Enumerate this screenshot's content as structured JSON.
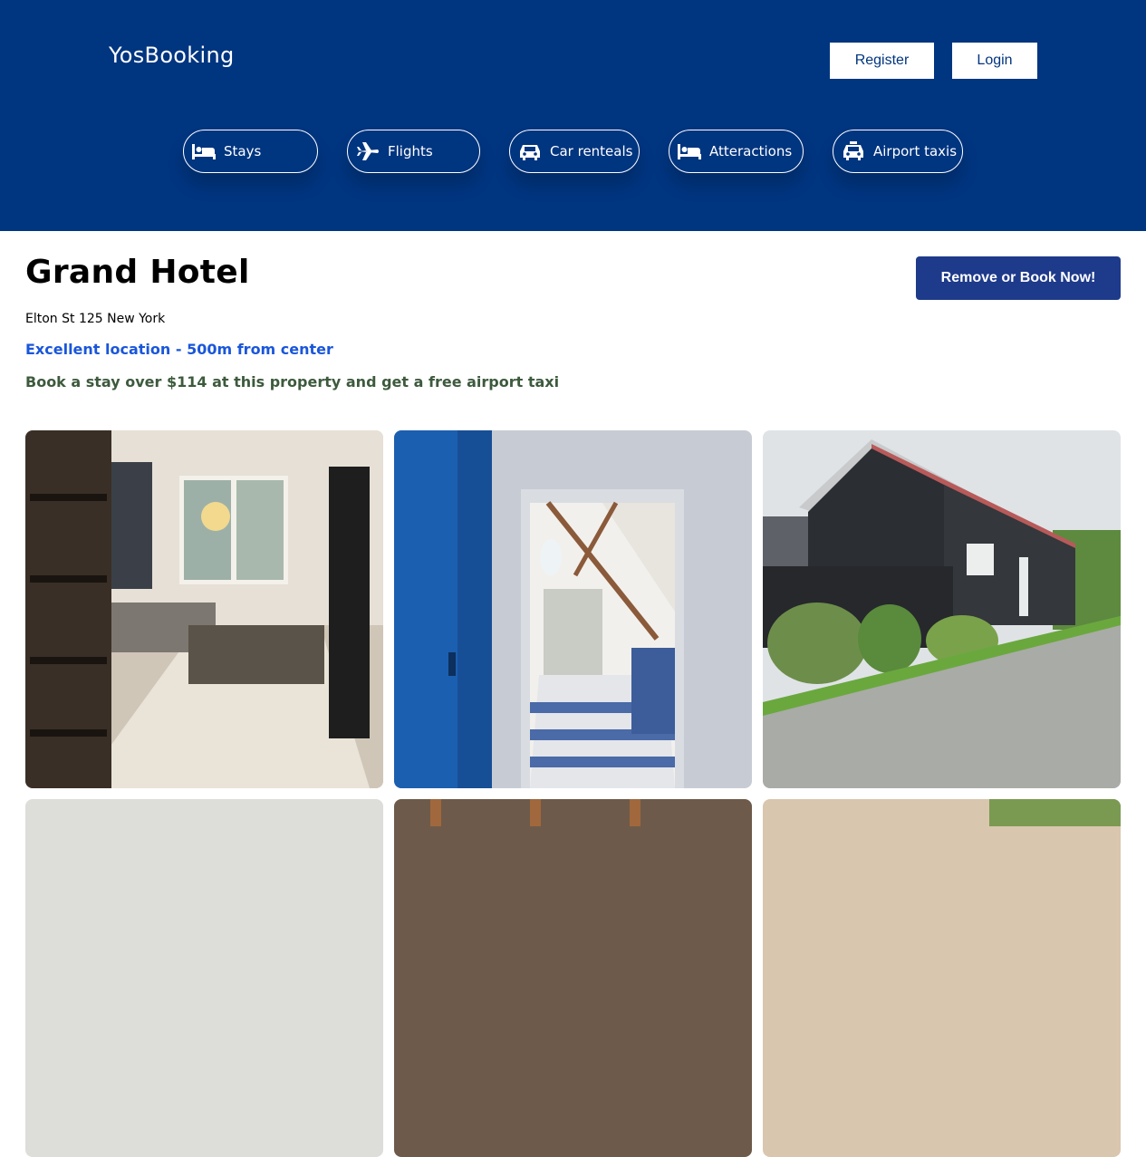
{
  "header": {
    "brand": "YosBooking",
    "register_label": "Register",
    "login_label": "Login",
    "nav": [
      {
        "label": "Stays",
        "icon": "bed-icon"
      },
      {
        "label": "Flights",
        "icon": "plane-icon"
      },
      {
        "label": "Car renteals",
        "icon": "car-icon"
      },
      {
        "label": "Atteractions",
        "icon": "bed-icon"
      },
      {
        "label": "Airport taxis",
        "icon": "taxi-icon"
      }
    ]
  },
  "hotel": {
    "name": "Grand Hotel",
    "book_button": "Remove or Book Now!",
    "address": "Elton St 125 New York",
    "location": "Excellent location - 500m from center",
    "offer": "Book a stay over $114 at this property and get a free airport taxi"
  },
  "colors": {
    "header_bg": "#003580",
    "book_button": "#1e3a8a",
    "location_text": "#1a56db",
    "offer_text": "#3d5a3d"
  },
  "gallery": {
    "photos": [
      {
        "icon": "living-room-photo"
      },
      {
        "icon": "attic-hallway-photo"
      },
      {
        "icon": "wooden-house-photo"
      },
      {
        "icon": "interior-photo"
      },
      {
        "icon": "wooden-ceiling-photo"
      },
      {
        "icon": "garden-photo"
      }
    ]
  }
}
